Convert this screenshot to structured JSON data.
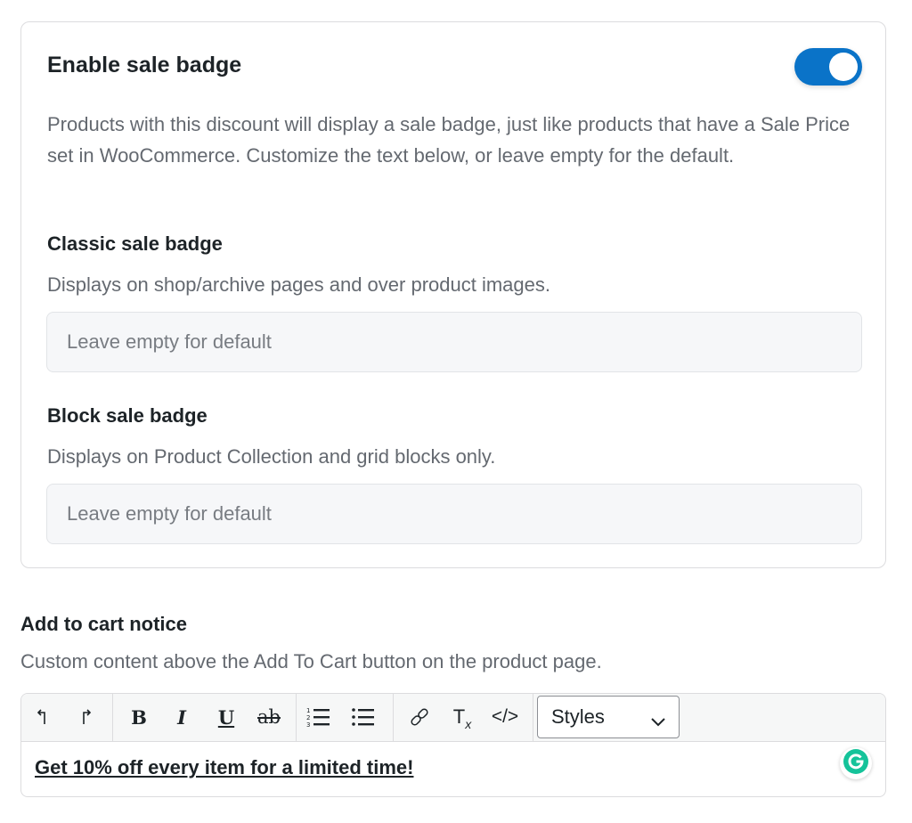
{
  "sale_badge": {
    "title": "Enable sale badge",
    "enabled": true,
    "description": "Products with this discount will display a sale badge, just like products that have a Sale Price set in WooCommerce. Customize the text below, or leave empty for the default.",
    "classic": {
      "title": "Classic sale badge",
      "description": "Displays on shop/archive pages and over product images.",
      "placeholder": "Leave empty for default",
      "value": ""
    },
    "block": {
      "title": "Block sale badge",
      "description": "Displays on Product Collection and grid blocks only.",
      "placeholder": "Leave empty for default",
      "value": ""
    }
  },
  "cart_notice": {
    "title": "Add to cart notice",
    "description": "Custom content above the Add To Cart button on the product page.",
    "toolbar": {
      "bold": "B",
      "italic": "I",
      "underline": "U",
      "strike": "ab",
      "clear_format": "T",
      "clear_format_sub": "x",
      "code": "</>",
      "styles_label": "Styles"
    },
    "content": "Get 10% off every item for a limited time!"
  },
  "icons": [
    "undo-icon",
    "redo-icon",
    "ordered-list-icon",
    "bullet-list-icon",
    "link-icon",
    "clear-format-icon",
    "code-icon",
    "chevron-down-icon",
    "grammarly-icon"
  ],
  "colors": {
    "toggle_on": "#0a73c8",
    "muted_text": "#646970",
    "grammarly": "#15c39a"
  }
}
